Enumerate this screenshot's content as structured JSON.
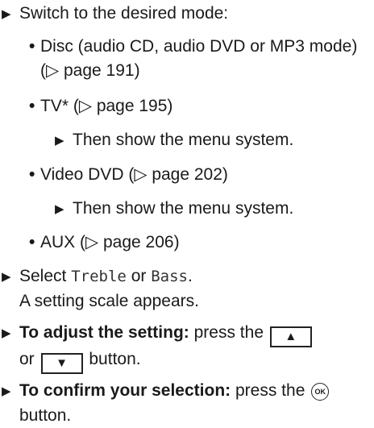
{
  "steps": {
    "switch": {
      "text": "Switch to the desired mode:",
      "modes": {
        "disc": {
          "line1": "Disc (audio CD, audio DVD or MP3 mode)",
          "ref": "(▷ page 191)"
        },
        "tv": {
          "label": "TV* (▷ page 195)",
          "sub": "Then show the menu system."
        },
        "video": {
          "label": "Video DVD (▷ page 202)",
          "sub": "Then show the menu system."
        },
        "aux": {
          "label": "AUX (▷ page 206)"
        }
      }
    },
    "select": {
      "prefix": "Select",
      "option1": "Treble",
      "or": "or",
      "option2": "Bass",
      "suffix": ".",
      "result": "A setting scale appears."
    },
    "adjust": {
      "bold": "To adjust the setting:",
      "text": "press the",
      "or": "or",
      "button_text": "button."
    },
    "confirm": {
      "bold": "To confirm your selection:",
      "text": "press the",
      "button_text": "button."
    }
  },
  "glyphs": {
    "step_arrow": "▶",
    "bullet": "•",
    "up_button": "▲",
    "down_button": "▼",
    "ok_button": "OK"
  }
}
